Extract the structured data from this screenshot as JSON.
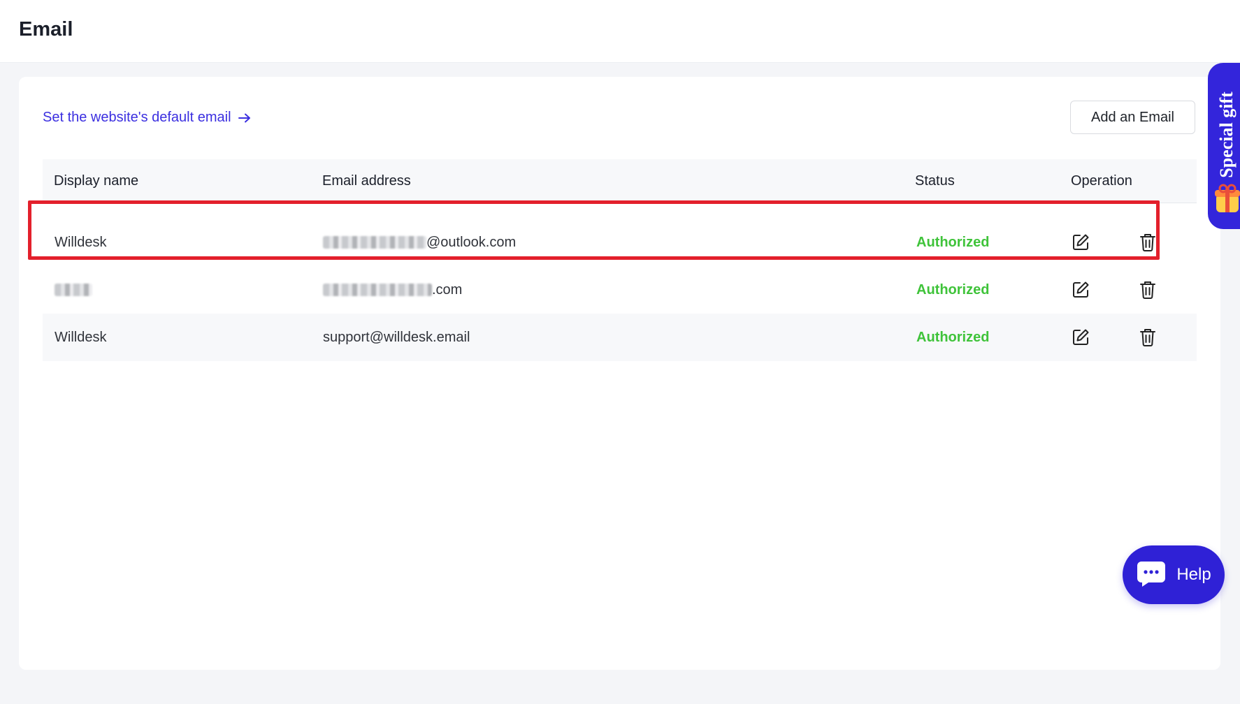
{
  "header": {
    "title": "Email"
  },
  "card": {
    "default_link": "Set the website's default email",
    "add_button": "Add an Email"
  },
  "table": {
    "columns": [
      "Display name",
      "Email address",
      "Status",
      "Operation"
    ],
    "rows": [
      {
        "display_name": "Willdesk",
        "email_suffix": "@outlook.com",
        "status": "Authorized"
      },
      {
        "display_name": "",
        "email_suffix": ".com",
        "status": "Authorized"
      },
      {
        "display_name": "Willdesk",
        "email_suffix": "support@willdesk.email",
        "status": "Authorized"
      }
    ]
  },
  "side_tab": {
    "label": "Special gift"
  },
  "help": {
    "label": "Help"
  },
  "colors": {
    "accent": "#3325db",
    "status_authorized": "#3fc33a",
    "highlight_border": "#e3202c"
  },
  "icons": [
    "arrow-right-icon",
    "edit-icon",
    "trash-icon",
    "gift-icon",
    "chat-bubble-icon"
  ]
}
